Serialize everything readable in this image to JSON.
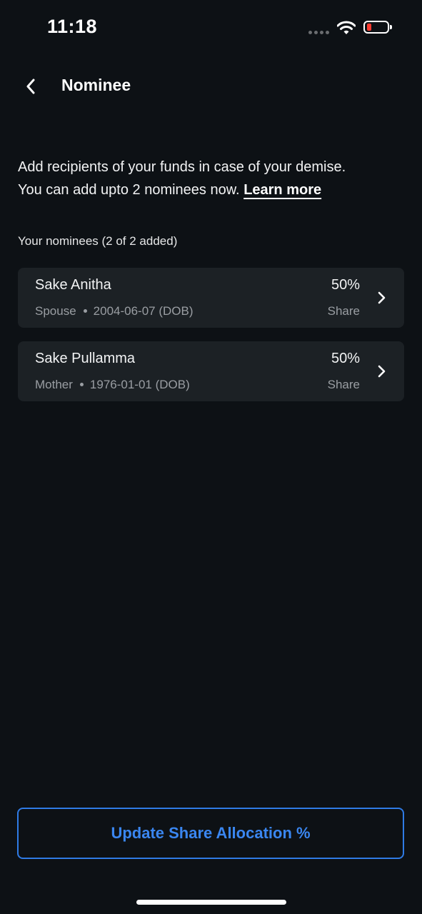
{
  "status_bar": {
    "time": "11:18",
    "signal_icon": "signal-dots-icon",
    "wifi_icon": "wifi-icon",
    "battery_icon": "battery-low-icon",
    "battery_color": "#ff3b30"
  },
  "header": {
    "back_icon": "chevron-left-icon",
    "title": "Nominee"
  },
  "intro": {
    "line1": "Add recipients of your funds in case of your demise.",
    "line2": "You can add upto 2 nominees now.",
    "learn_more": "Learn more"
  },
  "section_label": "Your nominees (2 of 2 added)",
  "nominees": [
    {
      "name": "Sake Anitha",
      "relation": "Spouse",
      "dob": "2004-06-07 (DOB)",
      "share": "50%",
      "share_label": "Share"
    },
    {
      "name": "Sake Pullamma",
      "relation": "Mother",
      "dob": "1976-01-01 (DOB)",
      "share": "50%",
      "share_label": "Share"
    }
  ],
  "update_button_label": "Update Share Allocation %",
  "colors": {
    "background": "#0d1115",
    "card": "#1c2125",
    "accent": "#3a86f0"
  }
}
